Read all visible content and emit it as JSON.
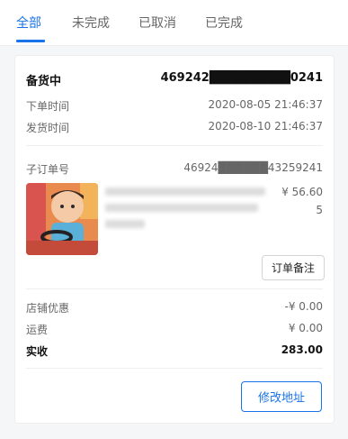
{
  "tabs": [
    {
      "label": "全部",
      "active": true
    },
    {
      "label": "未完成",
      "active": false
    },
    {
      "label": "已取消",
      "active": false
    },
    {
      "label": "已完成",
      "active": false
    }
  ],
  "order": {
    "status": "备货中",
    "order_no": "469242█████████0241",
    "order_time_label": "下单时间",
    "order_time": "2020-08-05 21:46:37",
    "ship_time_label": "发货时间",
    "ship_time": "2020-08-10 21:46:37"
  },
  "sub_order": {
    "label": "子订单号",
    "number": "46924██████43259241",
    "price": "¥ 56.60",
    "quantity": "5",
    "note_button": "订单备注"
  },
  "summary": {
    "discount_label": "店铺优惠",
    "discount_value": "-¥ 0.00",
    "shipping_label": "运费",
    "shipping_value": "¥ 0.00",
    "total_label": "实收",
    "total_value": "283.00"
  },
  "actions": {
    "modify_address": "修改地址"
  },
  "colors": {
    "accent": "#1a73e8",
    "divider": "#eeeeee",
    "background": "#f5f6f8"
  }
}
